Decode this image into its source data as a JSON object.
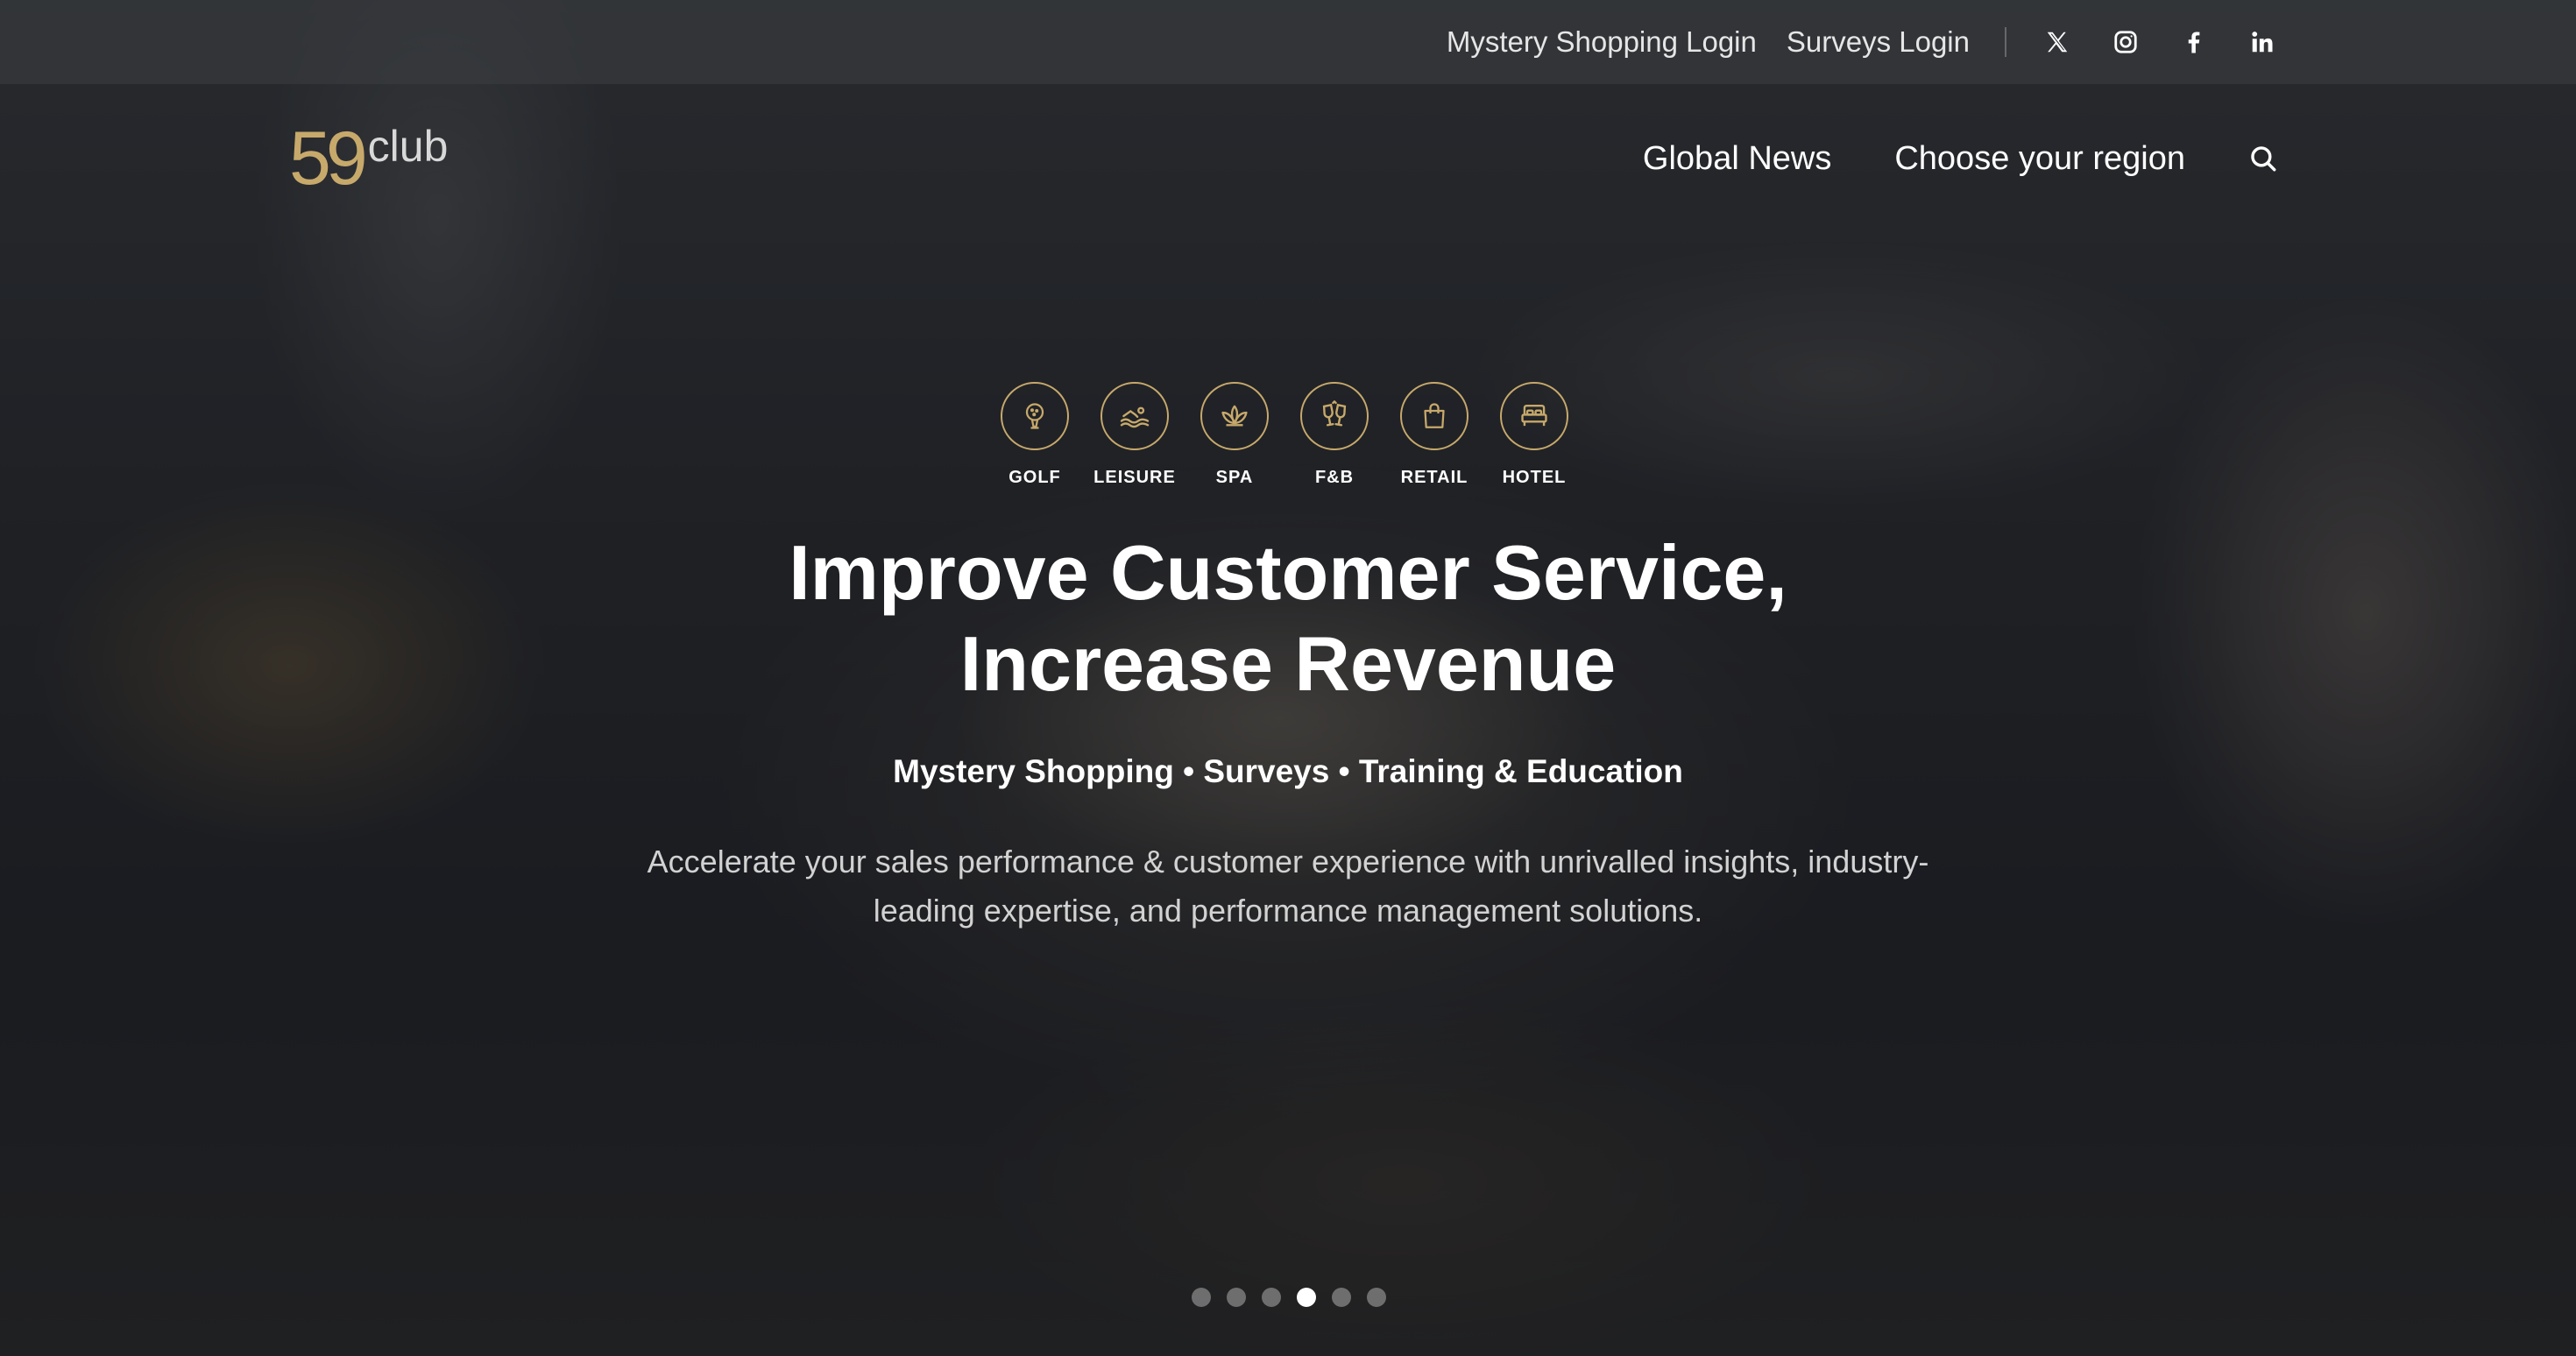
{
  "colors": {
    "accent_gold": "#c7a96b",
    "text_white": "#ffffff",
    "text_muted": "#d2d2d2",
    "utility_bar_bg": "#3c3e42"
  },
  "utility_bar": {
    "links": [
      {
        "label": "Mystery Shopping Login"
      },
      {
        "label": "Surveys Login"
      }
    ],
    "social_icons": [
      "x-icon",
      "instagram-icon",
      "facebook-icon",
      "linkedin-icon"
    ]
  },
  "logo": {
    "number": "59",
    "word": "club"
  },
  "main_nav": {
    "items": [
      {
        "label": "Global News"
      },
      {
        "label": "Choose your region"
      }
    ],
    "search_icon": "search-icon"
  },
  "sectors": [
    {
      "label": "GOLF",
      "icon": "golf-icon"
    },
    {
      "label": "LEISURE",
      "icon": "swimmer-icon"
    },
    {
      "label": "SPA",
      "icon": "lotus-icon"
    },
    {
      "label": "F&B",
      "icon": "glasses-icon"
    },
    {
      "label": "RETAIL",
      "icon": "shopping-bag-icon"
    },
    {
      "label": "HOTEL",
      "icon": "bed-icon"
    }
  ],
  "hero": {
    "title_line1": "Improve Customer Service,",
    "title_line2": "Increase Revenue",
    "subtitle": "Mystery Shopping • Surveys • Training & Education",
    "description": "Accelerate your sales performance & customer experience with unrivalled insights, industry-leading expertise, and performance management solutions."
  },
  "carousel": {
    "slide_count": 6,
    "active_index": 3
  }
}
